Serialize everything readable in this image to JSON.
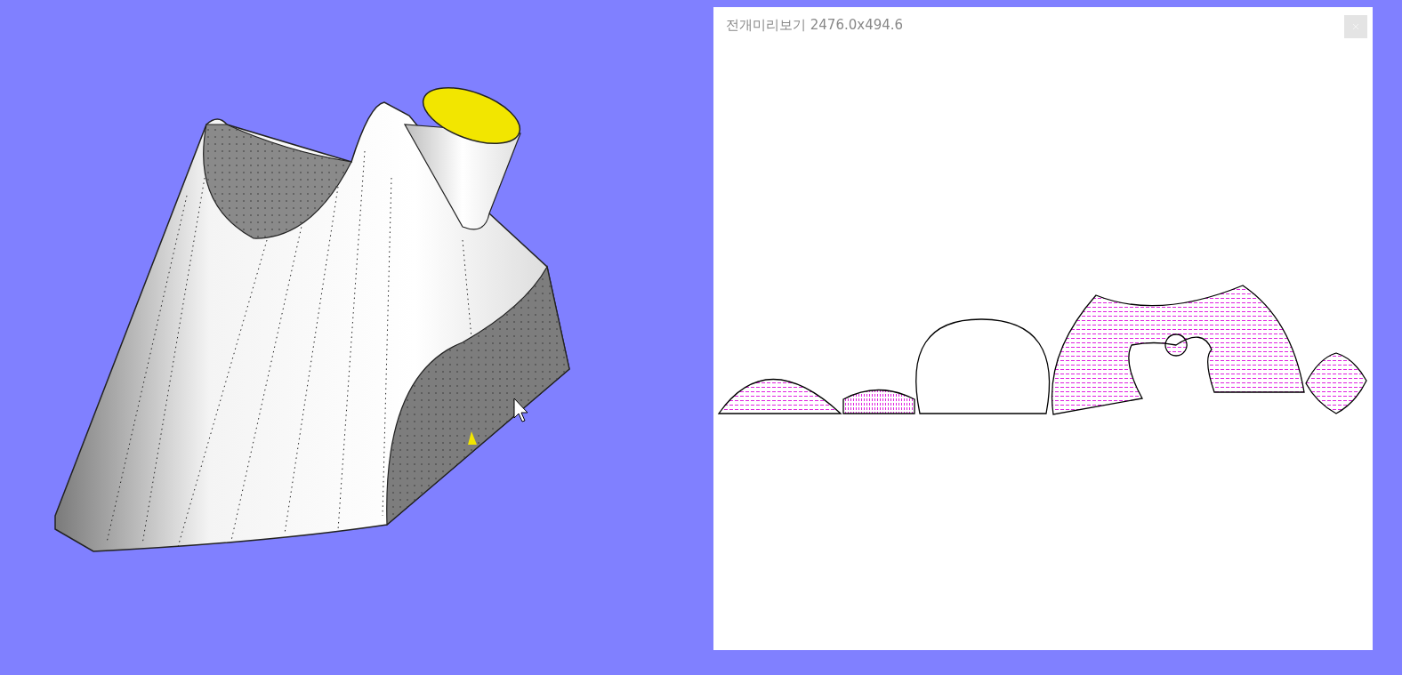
{
  "preview": {
    "title": "전개미리보기 2476.0x494.6"
  }
}
